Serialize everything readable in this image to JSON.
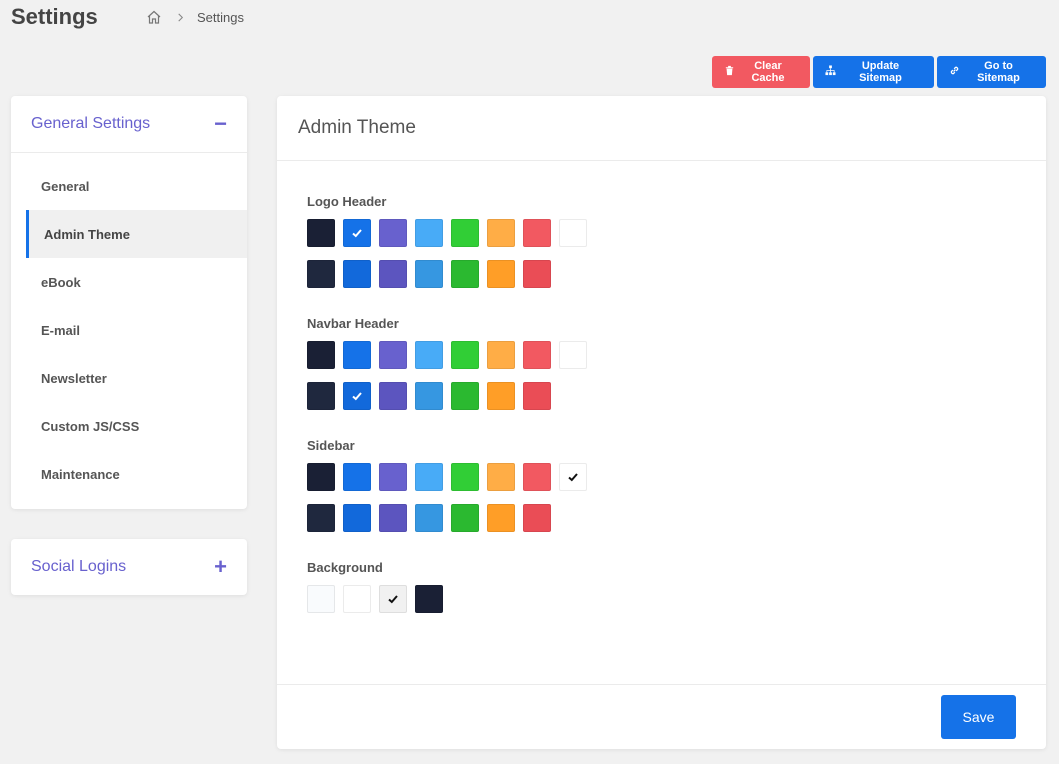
{
  "header": {
    "title": "Settings",
    "breadcrumb": {
      "current": "Settings"
    }
  },
  "actions": {
    "clear_cache": "Clear Cache",
    "update_sitemap": "Update Sitemap",
    "go_to_sitemap": "Go to Sitemap"
  },
  "sidebar": {
    "general": {
      "title": "General Settings",
      "toggle": "−",
      "items": [
        {
          "label": "General"
        },
        {
          "label": "Admin Theme",
          "active": true
        },
        {
          "label": "eBook"
        },
        {
          "label": "E-mail"
        },
        {
          "label": "Newsletter"
        },
        {
          "label": "Custom JS/CSS"
        },
        {
          "label": "Maintenance"
        }
      ]
    },
    "social": {
      "title": "Social Logins",
      "toggle": "+"
    }
  },
  "main": {
    "title": "Admin Theme",
    "save_label": "Save",
    "sections": [
      {
        "label": "Logo Header",
        "rows": [
          [
            {
              "c": "#1a2035"
            },
            {
              "c": "#1572e8",
              "sel": true
            },
            {
              "c": "#6861ce"
            },
            {
              "c": "#48abf7"
            },
            {
              "c": "#31ce36"
            },
            {
              "c": "#ffad46"
            },
            {
              "c": "#f25961"
            },
            {
              "c": "#ffffff"
            }
          ],
          [
            {
              "c": "#1f283e"
            },
            {
              "c": "#1269db"
            },
            {
              "c": "#5c55bf"
            },
            {
              "c": "#3697e1"
            },
            {
              "c": "#2bb930"
            },
            {
              "c": "#ff9e27"
            },
            {
              "c": "#ea4d56"
            }
          ]
        ]
      },
      {
        "label": "Navbar Header",
        "rows": [
          [
            {
              "c": "#1a2035"
            },
            {
              "c": "#1572e8"
            },
            {
              "c": "#6861ce"
            },
            {
              "c": "#48abf7"
            },
            {
              "c": "#31ce36"
            },
            {
              "c": "#ffad46"
            },
            {
              "c": "#f25961"
            },
            {
              "c": "#ffffff"
            }
          ],
          [
            {
              "c": "#1f283e"
            },
            {
              "c": "#1269db",
              "sel": true
            },
            {
              "c": "#5c55bf"
            },
            {
              "c": "#3697e1"
            },
            {
              "c": "#2bb930"
            },
            {
              "c": "#ff9e27"
            },
            {
              "c": "#ea4d56"
            }
          ]
        ]
      },
      {
        "label": "Sidebar",
        "rows": [
          [
            {
              "c": "#1a2035"
            },
            {
              "c": "#1572e8"
            },
            {
              "c": "#6861ce"
            },
            {
              "c": "#48abf7"
            },
            {
              "c": "#31ce36"
            },
            {
              "c": "#ffad46"
            },
            {
              "c": "#f25961"
            },
            {
              "c": "#ffffff",
              "sel": true
            }
          ],
          [
            {
              "c": "#1f283e"
            },
            {
              "c": "#1269db"
            },
            {
              "c": "#5c55bf"
            },
            {
              "c": "#3697e1"
            },
            {
              "c": "#2bb930"
            },
            {
              "c": "#ff9e27"
            },
            {
              "c": "#ea4d56"
            }
          ]
        ]
      },
      {
        "label": "Background",
        "rows": [
          [
            {
              "c": "#f9fbfd"
            },
            {
              "c": "#ffffff"
            },
            {
              "c": "#f1f1f1",
              "sel": true
            },
            {
              "c": "#1a2035"
            }
          ]
        ]
      }
    ]
  }
}
